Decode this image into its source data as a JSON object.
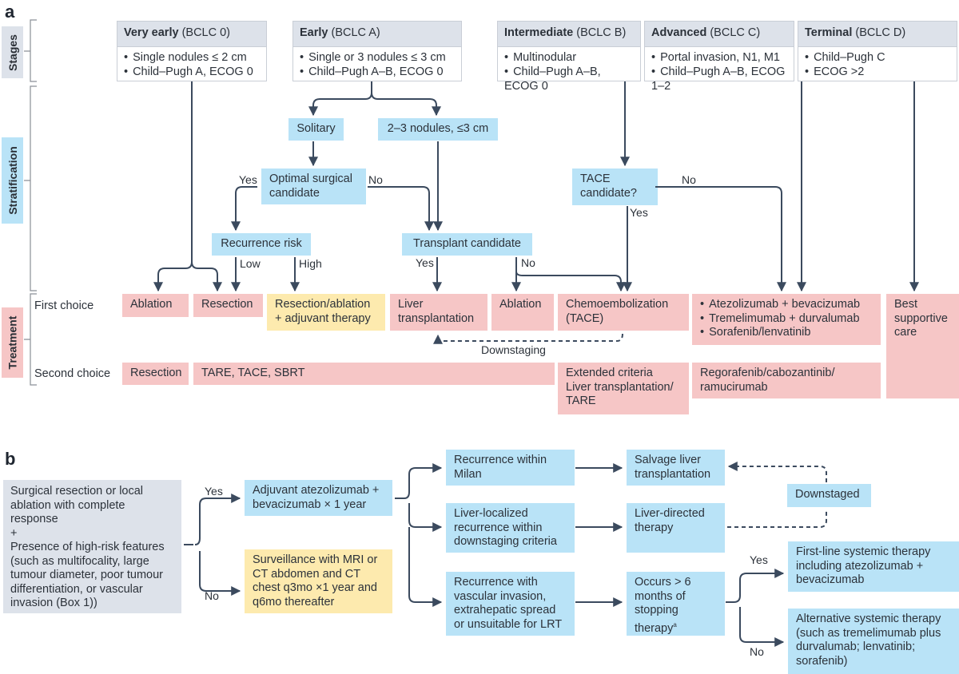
{
  "panel_a": {
    "letter": "a",
    "side_labels": {
      "stages": "Stages",
      "stratification": "Stratification",
      "treatment": "Treatment"
    },
    "stages": [
      {
        "name": "Very early",
        "code": "(BCLC 0)",
        "criteria": [
          "Single nodules ≤ 2 cm",
          "Child–Pugh A, ECOG 0"
        ]
      },
      {
        "name": "Early",
        "code": "(BCLC A)",
        "criteria": [
          "Single or 3 nodules ≤ 3 cm",
          "Child–Pugh A–B, ECOG 0"
        ]
      },
      {
        "name": "Intermediate",
        "code": "(BCLC B)",
        "criteria": [
          "Multinodular",
          "Child–Pugh A–B, ECOG 0"
        ]
      },
      {
        "name": "Advanced",
        "code": "(BCLC C)",
        "criteria": [
          "Portal invasion, N1, M1",
          "Child–Pugh A–B, ECOG 1–2"
        ]
      },
      {
        "name": "Terminal",
        "code": "(BCLC D)",
        "criteria": [
          "Child–Pugh C",
          "ECOG >2"
        ]
      }
    ],
    "stratification": {
      "solitary": "Solitary",
      "nodules": "2–3 nodules, ≤3 cm",
      "optimal_surgical": "Optimal surgical candidate",
      "recurrence_risk": "Recurrence risk",
      "transplant_candidate": "Transplant candidate",
      "tace_candidate": "TACE candidate?"
    },
    "edge_labels": {
      "yes": "Yes",
      "no": "No",
      "low": "Low",
      "high": "High",
      "downstaging": "Downstaging"
    },
    "treatment": {
      "first_choice_label": "First choice",
      "second_choice_label": "Second choice",
      "first": {
        "ablation": "Ablation",
        "resection": "Resection",
        "resection_adjuvant": "Resection/ablation + adjuvant therapy",
        "liver_transplantation": "Liver transplantation",
        "ablation2": "Ablation",
        "chemoembolization": "Chemoembolization (TACE)",
        "systemic": [
          "Atezolizumab + bevacizumab",
          "Tremelimumab + durvalumab",
          "Sorafenib/lenvatinib"
        ],
        "best_supportive": "Best supportive care"
      },
      "second": {
        "resection": "Resection",
        "tare_tace_sbrt": "TARE, TACE, SBRT",
        "extended": "Extended criteria Liver transplantation/ TARE",
        "regorafenib": "Regorafenib/cabozantinib/ ramucirumab"
      }
    }
  },
  "panel_b": {
    "letter": "b",
    "start": {
      "line1": "Surgical resection or local ablation with complete response",
      "plus": "+",
      "line2": "Presence of high-risk features (such as multifocality, large tumour diameter, poor tumour differentiation, or vascular invasion (Box 1))"
    },
    "adjuvant": "Adjuvant atezolizumab + bevacizumab × 1 year",
    "surveillance": "Surveillance with MRI or CT abdomen and CT chest q3mo ×1 year and q6mo thereafter",
    "recurrence_milan": "Recurrence within Milan",
    "liver_localized": "Liver-localized recurrence within downstaging criteria",
    "recurrence_vascular": "Recurrence with vascular invasion, extrahepatic spread or unsuitable for LRT",
    "salvage": "Salvage liver transplantation",
    "liver_directed": "Liver-directed therapy",
    "downstaged": "Downstaged",
    "occurs": "Occurs > 6 months of stopping therapy",
    "occurs_footnote": "a",
    "first_line": "First-line systemic therapy including atezolizumab + bevacizumab",
    "alternative": "Alternative systemic therapy (such as tremelimumab plus durvalumab; lenvatinib; sorafenib)",
    "edge_labels": {
      "yes": "Yes",
      "no": "No"
    }
  }
}
